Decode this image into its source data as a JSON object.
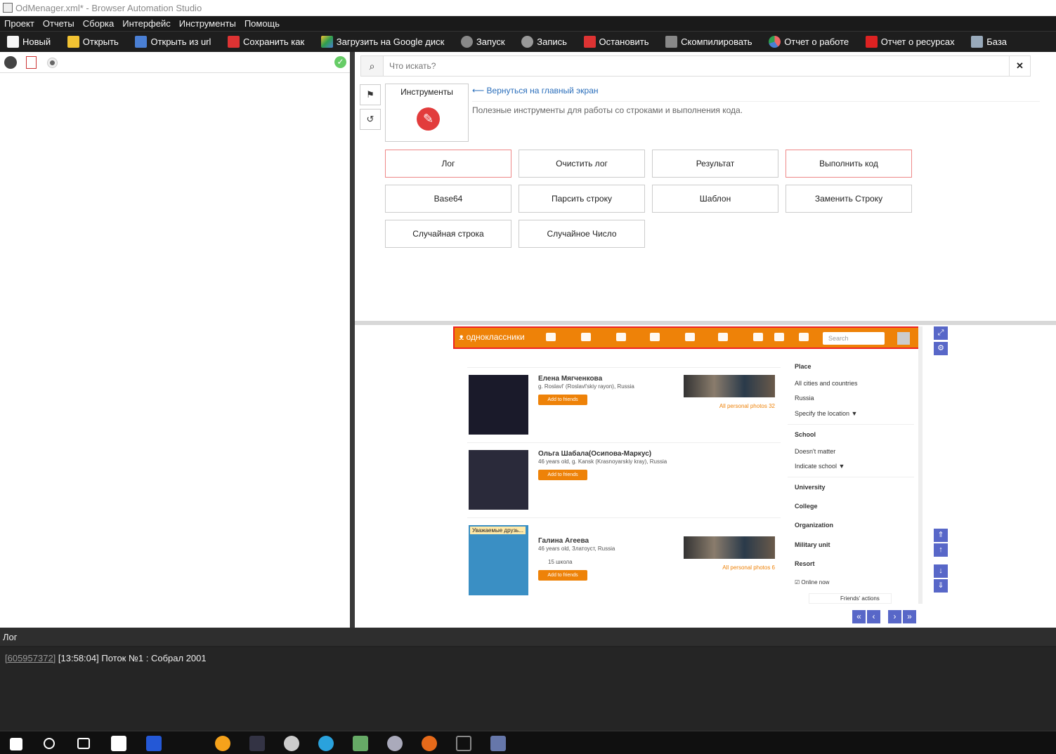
{
  "window": {
    "title": "OdMenager.xml* - Browser Automation Studio"
  },
  "menu": [
    "Проект",
    "Отчеты",
    "Сборка",
    "Интерфейс",
    "Инструменты",
    "Помощь"
  ],
  "toolbar": [
    {
      "label": "Новый",
      "icon": "new-file-icon",
      "color": "#f5f5f5"
    },
    {
      "label": "Открыть",
      "icon": "open-folder-icon",
      "color": "#f1c232"
    },
    {
      "label": "Открыть из url",
      "icon": "download-arrow-icon",
      "color": "#4a7fd4"
    },
    {
      "label": "Сохранить как",
      "icon": "save-disk-icon",
      "color": "#d33"
    },
    {
      "label": "Загрузить на Google диск",
      "icon": "google-drive-icon",
      "color": "#2e9e4f"
    },
    {
      "label": "Запуск",
      "icon": "play-icon",
      "color": "#888"
    },
    {
      "label": "Запись",
      "icon": "record-icon",
      "color": "#999"
    },
    {
      "label": "Остановить",
      "icon": "stop-icon",
      "color": "#d33"
    },
    {
      "label": "Скомпилировать",
      "icon": "compile-box-icon",
      "color": "#888"
    },
    {
      "label": "Отчет о работе",
      "icon": "pie-chart-icon",
      "color": "#e66"
    },
    {
      "label": "Отчет о ресурсах",
      "icon": "resource-report-icon",
      "color": "#d22"
    },
    {
      "label": "База",
      "icon": "database-icon",
      "color": "#9ab"
    }
  ],
  "search": {
    "placeholder": "Что искать?"
  },
  "tools": {
    "card_title": "Инструменты",
    "back_link": "⟵ Вернуться на главный экран",
    "description": "Полезные инструменты для работы со строками и выполнения кода.",
    "buttons": [
      "Лог",
      "Очистить лог",
      "Результат",
      "Выполнить код",
      "Base64",
      "Парсить строку",
      "Шаблон",
      "Заменить Строку",
      "Случайная строка",
      "Случайное Число"
    ]
  },
  "browser": {
    "site_name": "одноклассники",
    "search_placeholder": "Search",
    "people": [
      {
        "name": "Елена Мягченкова",
        "info": "g. Roslavl' (Roslavl'skiy rayon), Russia",
        "button": "Add to friends",
        "photos": "All personal photos 32"
      },
      {
        "name": "Ольга Шабала(Осипова-Маркус)",
        "info": "46 years old, g. Kansk (Krasnoyarskiy kray), Russia",
        "button": "Add to friends"
      },
      {
        "name": "Галина Агеева",
        "info": "46 years old, Златоуст, Russia",
        "extra": "15 школа",
        "button": "Add to friends",
        "photos": "All personal photos 6",
        "photo_caption": "Уважаемые друзь..."
      }
    ],
    "filters": {
      "place": "Place",
      "all_cities": "All cities and countries",
      "russia": "Russia",
      "specify_location": "Specify the location ▼",
      "school": "School",
      "doesnt_matter": "Doesn't matter",
      "indicate_school": "Indicate school ▼",
      "sections": [
        "University",
        "College",
        "Organization",
        "Military unit",
        "Resort"
      ],
      "online_now": "Online now",
      "friends_actions": "Friends' actions"
    }
  },
  "css_path": ">CSS> #topPanel > :nth-child(1) > :nth-child(1)",
  "log": {
    "title": "Лог",
    "entry_id": "[605957372]",
    "entry_text": " [13:58:04] Поток №1 : Собрал 2001"
  }
}
